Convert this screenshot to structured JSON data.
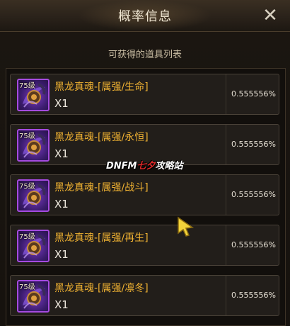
{
  "header": {
    "title": "概率信息",
    "close_icon": "close-icon"
  },
  "subtitle": "可获得的道具列表",
  "items": [
    {
      "level": "75级",
      "name": "黑龙真魂-[属强/生命]",
      "quantity": "X1",
      "probability": "0.555556%",
      "icon": "dragon-soul-icon"
    },
    {
      "level": "75级",
      "name": "黑龙真魂-[属强/永恒]",
      "quantity": "X1",
      "probability": "0.555556%",
      "icon": "dragon-soul-icon"
    },
    {
      "level": "75级",
      "name": "黑龙真魂-[属强/战斗]",
      "quantity": "X1",
      "probability": "0.555556%",
      "icon": "dragon-soul-icon"
    },
    {
      "level": "75级",
      "name": "黑龙真魂-[属强/再生]",
      "quantity": "X1",
      "probability": "0.555556%",
      "icon": "dragon-soul-icon"
    },
    {
      "level": "75级",
      "name": "黑龙真魂-[属强/凛冬]",
      "quantity": "X1",
      "probability": "0.555556%",
      "icon": "dragon-soul-icon"
    }
  ],
  "watermark": {
    "prefix": "DNFM",
    "highlight": "七夕",
    "suffix": "攻略站"
  },
  "colors": {
    "item_name": "#f0b232",
    "icon_border": "#a54be0",
    "watermark_highlight": "#e02a2a"
  }
}
